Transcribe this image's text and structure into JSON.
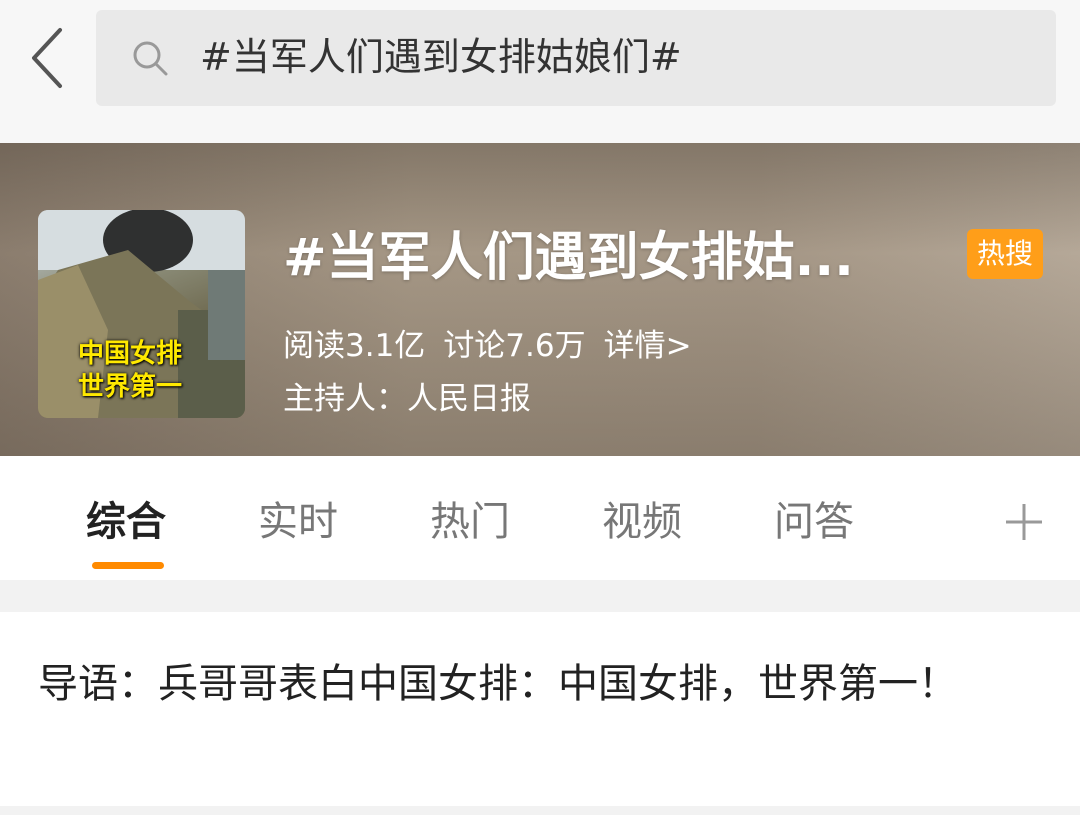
{
  "search": {
    "query": "#当军人们遇到女排姑娘们#"
  },
  "topic": {
    "title": "#当军人们遇到女排姑...",
    "hot_badge": "热搜",
    "reads": "阅读3.1亿",
    "discussions": "讨论7.6万",
    "details_link": "详情>",
    "host": "主持人：人民日报",
    "thumbnail_caption_line1": "中国女排",
    "thumbnail_caption_line2": "世界第一"
  },
  "tabs": [
    "综合",
    "实时",
    "热门",
    "视频",
    "问答"
  ],
  "intro": {
    "text": "导语：兵哥哥表白中国女排：中国女排，世界第一！"
  },
  "colors": {
    "accent": "#ff8a00",
    "hot_badge": "#ff9e19",
    "caption": "#ffe900"
  },
  "icons": {
    "back": "chevron-left-icon",
    "search": "search-icon",
    "add": "plus-icon"
  }
}
